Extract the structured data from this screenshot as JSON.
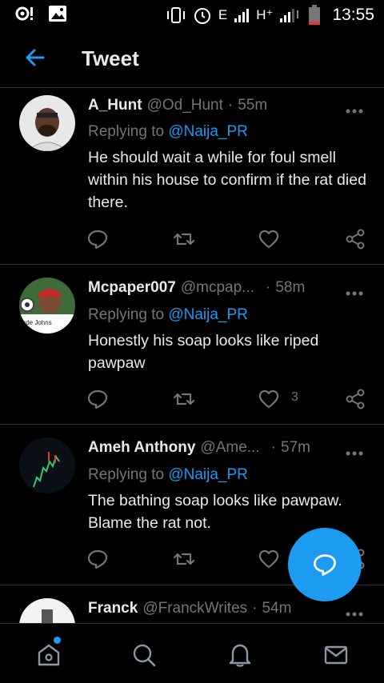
{
  "status_bar": {
    "network_label": "E",
    "network_label_2": "H⁺",
    "time": "13:55"
  },
  "header": {
    "title": "Tweet"
  },
  "tweets": [
    {
      "name": "A_Hunt",
      "handle": "@Od_Hunt",
      "separator": "·",
      "time": "55m",
      "replying_prefix": "Replying to",
      "replying_to": "@Naija_PR",
      "text": "He should wait a while for foul smell within his house to confirm if the rat died there.",
      "like_count": ""
    },
    {
      "name": "Mcpaper007",
      "handle": "@mcpap...",
      "separator": "·",
      "time": "58m",
      "replying_prefix": "Replying to",
      "replying_to": "@Naija_PR",
      "text": "Honestly his soap looks like riped pawpaw",
      "like_count": "3",
      "avatar_caption": "lade Johns"
    },
    {
      "name": "Ameh Anthony",
      "handle": "@Ame...",
      "separator": "·",
      "time": "57m",
      "replying_prefix": "Replying to",
      "replying_to": "@Naija_PR",
      "text": "The bathing soap looks like pawpaw. Blame the rat not.",
      "like_count": ""
    },
    {
      "name": "Franck",
      "handle": "@FranckWrites",
      "separator": "·",
      "time": "54m"
    }
  ],
  "colors": {
    "accent": "#1d9bf0",
    "background": "#000000",
    "muted": "#71767b",
    "divider": "#2f3336"
  }
}
